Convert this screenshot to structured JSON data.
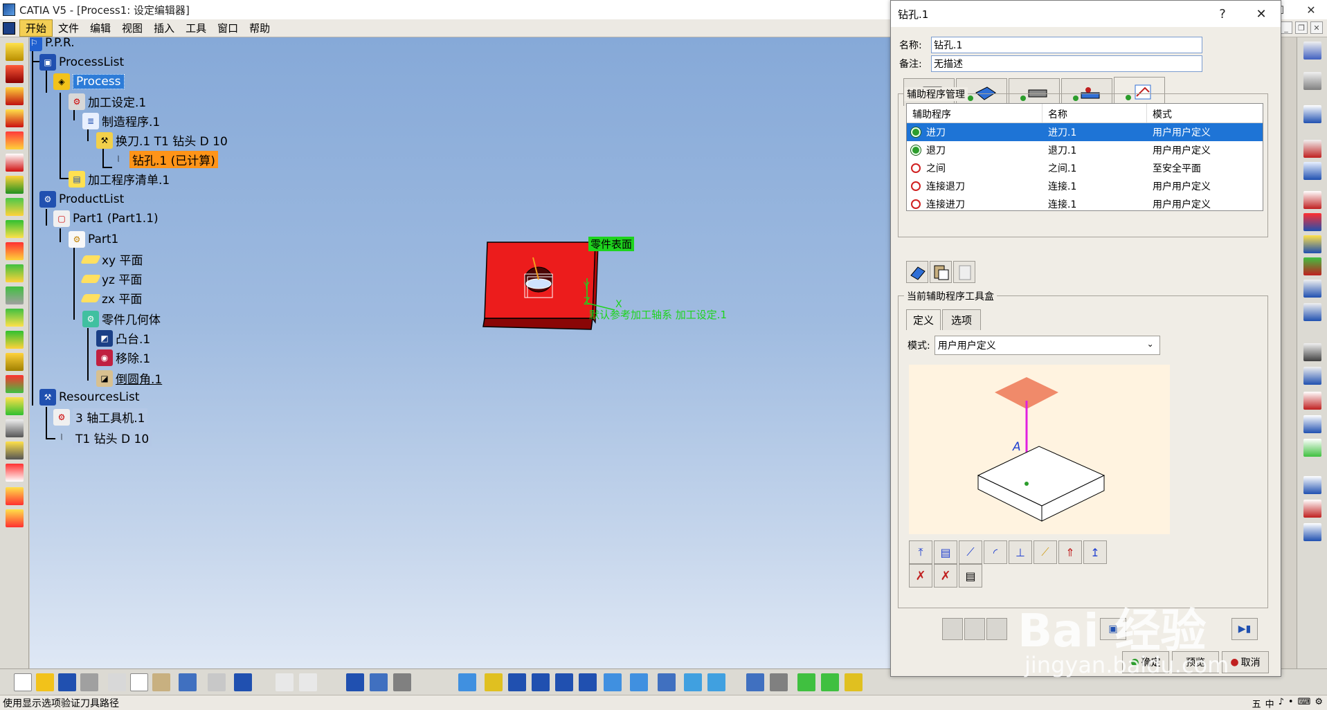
{
  "window": {
    "title": "CATIA V5 - [Process1: 设定编辑器]",
    "minimize": "—",
    "maximize": "☐",
    "close": "✕"
  },
  "menu": {
    "items": [
      "开始",
      "文件",
      "编辑",
      "视图",
      "插入",
      "工具",
      "窗口",
      "帮助"
    ]
  },
  "tree": {
    "root": "P.P.R.",
    "process_list": "ProcessList",
    "process": "Process",
    "machining_setup": "加工设定.1",
    "manufacturing_program": "制造程序.1",
    "tool_change": "换刀.1  T1 钻头 D 10",
    "drilling": "钻孔.1 (已计算)",
    "machining_list": "加工程序清单.1",
    "product_list": "ProductList",
    "part1_instance": "Part1 (Part1.1)",
    "part1": "Part1",
    "xy_plane": "xy 平面",
    "yz_plane": "yz 平面",
    "zx_plane": "zx 平面",
    "part_body": "零件几何体",
    "pad": "凸台.1",
    "pocket": "移除.1",
    "chamfer": "倒圆角.1",
    "resources_list": "ResourcesList",
    "machine": "3 轴工具机.1",
    "tool": "T1 钻头 D 10"
  },
  "viewport": {
    "surface_label": "零件表面",
    "axis_label": "默认参考加工轴系 加工设定.1",
    "axis_x": "X",
    "axis_y": "Y",
    "axis_z": "Z"
  },
  "dialog": {
    "title": "钻孔.1",
    "help": "?",
    "close": "✕",
    "name_label": "名称:",
    "name_value": "钻孔.1",
    "comment_label": "备注:",
    "comment_value": "无描述",
    "macro_group_title": "辅助程序管理",
    "table": {
      "headers": [
        "辅助程序",
        "名称",
        "模式"
      ],
      "rows": [
        {
          "macro": "进刀",
          "name": "进刀.1",
          "mode": "用户用户定义",
          "active": true,
          "selected": true
        },
        {
          "macro": "退刀",
          "name": "退刀.1",
          "mode": "用户用户定义",
          "active": true,
          "selected": false
        },
        {
          "macro": "之间",
          "name": "之间.1",
          "mode": "至安全平面",
          "active": false,
          "selected": false
        },
        {
          "macro": "连接退刀",
          "name": "连接.1",
          "mode": "用户用户定义",
          "active": false,
          "selected": false
        },
        {
          "macro": "连接进刀",
          "name": "连接.1",
          "mode": "用户用户定义",
          "active": false,
          "selected": false
        }
      ]
    },
    "toolbox_group_title": "当前辅助程序工具盒",
    "inner_tabs": [
      "定义",
      "选项"
    ],
    "mode_label": "模式:",
    "mode_value": "用户用户定义",
    "sketch_label": "A",
    "ok_label": "确定",
    "preview_label": "预览",
    "cancel_label": "取消"
  },
  "status": {
    "text": "使用显示选项验证刀具路径",
    "ime": [
      "五",
      "中",
      "♪",
      "•",
      "⌨",
      "⚙"
    ]
  },
  "watermark": {
    "brand": "Bai 经验",
    "url": "jingyan.baidu.com"
  },
  "colors": {
    "selection": "#1e74d6",
    "highlight": "#ff9418",
    "part": "#e81c1c",
    "green_label": "#1ed41e"
  }
}
